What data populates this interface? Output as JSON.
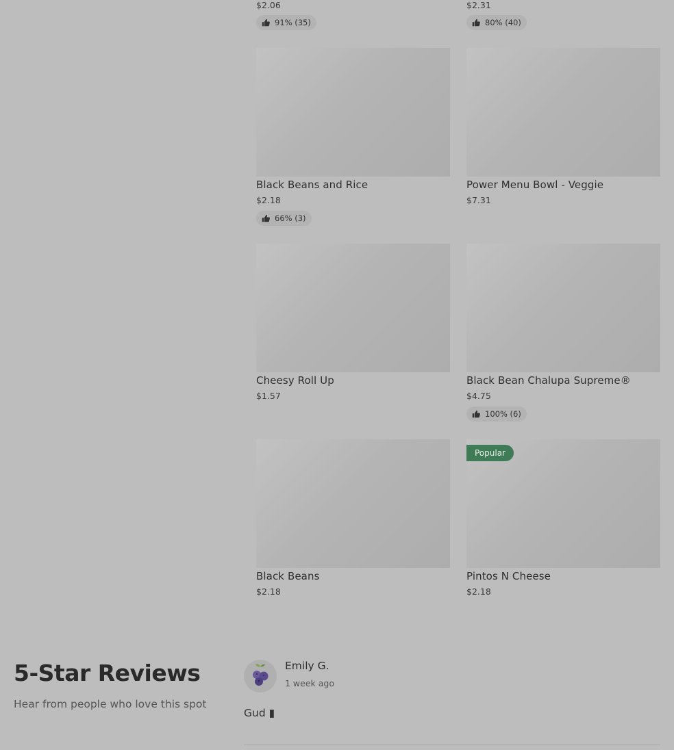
{
  "menu": {
    "items": [
      {
        "name": "",
        "price": "$2.06",
        "rating": "91% (35)"
      },
      {
        "name": "",
        "price": "$2.31",
        "rating": "80% (40)"
      },
      {
        "name": "Black Beans and Rice",
        "price": "$2.18",
        "rating": "66% (3)"
      },
      {
        "name": "Power Menu Bowl - Veggie",
        "price": "$7.31",
        "rating": ""
      },
      {
        "name": "Cheesy Roll Up",
        "price": "$1.57",
        "rating": ""
      },
      {
        "name": "Black Bean Chalupa Supreme®",
        "price": "$4.75",
        "rating": "100% (6)"
      },
      {
        "name": "Black Beans",
        "price": "$2.18",
        "rating": ""
      },
      {
        "name": "Pintos N Cheese",
        "price": "$2.18",
        "rating": "",
        "badge": "Popular"
      }
    ]
  },
  "reviews": {
    "title": "5-Star Reviews",
    "subtitle": "Hear from people who love this spot",
    "items": [
      {
        "author": "Emily G.",
        "time": "1 week ago",
        "text": "Gud ▮",
        "avatar_icon": "blueberry-icon"
      }
    ]
  },
  "icons": {
    "rating": "thumbs-up-icon"
  },
  "colors": {
    "badge": "#3f7b57",
    "background": "#bdbdbd"
  }
}
